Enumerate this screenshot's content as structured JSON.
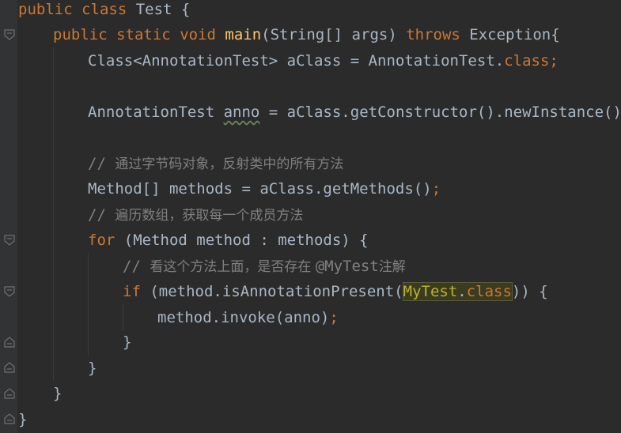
{
  "code": {
    "l1": {
      "kw1": "public",
      "kw2": "class",
      "rest": " Test {"
    },
    "l2": {
      "kw1": "public",
      "kw2": "static",
      "kw3": "void",
      "fn": "main",
      "p1": "(String[] args) ",
      "kw4": "throws",
      "p2": " Exception{"
    },
    "l3": {
      "p1": "Class<AnnotationTest> aClass = AnnotationTest.",
      "kw": "class",
      "semi": ";"
    },
    "l4": {
      "p1": "AnnotationTest ",
      "warn": "anno",
      "p2": " = aClass.getConstructor().newInstance()",
      "semi": ";"
    },
    "l5": {
      "slash": "// ",
      "text": "通过字节码对象，反射类中的所有方法"
    },
    "l6": {
      "p1": "Method[] methods = aClass.getMethods()",
      "semi": ";"
    },
    "l7": {
      "slash": "// ",
      "text": "遍历数组，获取每一个成员方法"
    },
    "l8": {
      "kw": "for",
      "p1": " (Method method : methods) {"
    },
    "l9": {
      "slash": "// ",
      "text1": "看这个方法上面，是否存在 ",
      "mono": "@MyTest",
      "text2": "注解"
    },
    "l10": {
      "kw": "if",
      "p1": " (method.isAnnotationPresent(",
      "anno": "MyTest",
      "dot": ".",
      "kw2": "class",
      "p2": ")) {"
    },
    "l11": {
      "p1": "method.invoke(anno)",
      "semi": ";"
    },
    "l12": {
      "p1": "}"
    },
    "l13": {
      "p1": "}"
    },
    "l14": {
      "p1": "}"
    },
    "l15": {
      "p1": "}"
    }
  },
  "colors": {
    "background": "#2b2b2b",
    "keyword": "#cc7832",
    "function": "#ffc66d",
    "comment": "#808080",
    "default": "#a9b7c6",
    "annotation": "#bbb529"
  },
  "gutter_icons": [
    "fold-open-icon",
    "fold-open-icon",
    "fold-open-icon",
    "fold-open-icon",
    "fold-close-icon",
    "fold-close-icon",
    "fold-close-icon"
  ]
}
